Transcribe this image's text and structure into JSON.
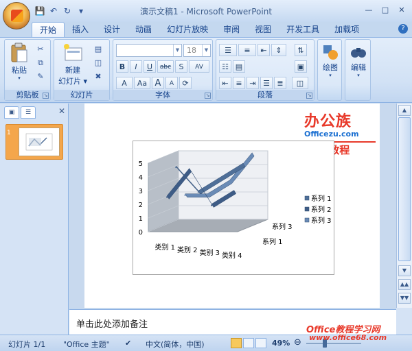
{
  "window": {
    "title": "演示文稿1 - Microsoft PowerPoint",
    "controls": [
      "minimize-icon",
      "maximize-icon",
      "close-icon"
    ]
  },
  "qat": [
    "save-icon",
    "undo-icon",
    "redo-icon",
    "customize-icon"
  ],
  "tabs": [
    {
      "label": "开始",
      "active": true
    },
    {
      "label": "插入"
    },
    {
      "label": "设计"
    },
    {
      "label": "动画"
    },
    {
      "label": "幻灯片放映"
    },
    {
      "label": "审阅"
    },
    {
      "label": "视图"
    },
    {
      "label": "开发工具"
    },
    {
      "label": "加载项"
    }
  ],
  "ribbon": {
    "clipboard": {
      "label": "剪贴板",
      "paste": "粘贴"
    },
    "slides": {
      "label": "幻灯片",
      "new_slide_line1": "新建",
      "new_slide_line2": "幻灯片"
    },
    "font": {
      "label": "字体",
      "font_size": "18",
      "font_name": "",
      "buttons": [
        "B",
        "I",
        "U",
        "abc",
        "S",
        "AV"
      ],
      "row3": [
        "A",
        "Aa",
        "A",
        "A"
      ]
    },
    "paragraph": {
      "label": "段落"
    },
    "drawing": {
      "label": "绘图"
    },
    "editing": {
      "label": "编辑"
    }
  },
  "left_panel": {
    "slide_number": "1"
  },
  "watermark": {
    "brand": "办公族",
    "url": "Officezu.com",
    "ppt": "PPT教程",
    "site1": "Office教程学习网",
    "site2": "www.office68.com"
  },
  "chart_data": {
    "type": "line",
    "subtype": "3d-line",
    "categories": [
      "类别 1",
      "类别 2",
      "类别 3",
      "类别 4"
    ],
    "series": [
      {
        "name": "系列 1",
        "values": [
          4.3,
          2.5,
          3.5,
          4.5
        ],
        "color": "#4f6f98"
      },
      {
        "name": "系列 2",
        "values": [
          2.4,
          4.4,
          1.8,
          2.8
        ],
        "color": "#3e5c86"
      },
      {
        "name": "系列 3",
        "values": [
          2.0,
          2.0,
          3.0,
          5.0
        ],
        "color": "#6a8bb6"
      }
    ],
    "depth_labels": [
      "系列 3",
      "系列 1"
    ],
    "ylim": [
      0,
      5
    ],
    "yticks": [
      "0",
      "1",
      "2",
      "3",
      "4",
      "5"
    ],
    "legend": "right",
    "grid": true
  },
  "notes": {
    "placeholder": "单击此处添加备注"
  },
  "status": {
    "slide": "幻灯片 1/1",
    "theme": "\"Office 主题\"",
    "language": "中文(简体，中国)",
    "zoom": "49%"
  }
}
